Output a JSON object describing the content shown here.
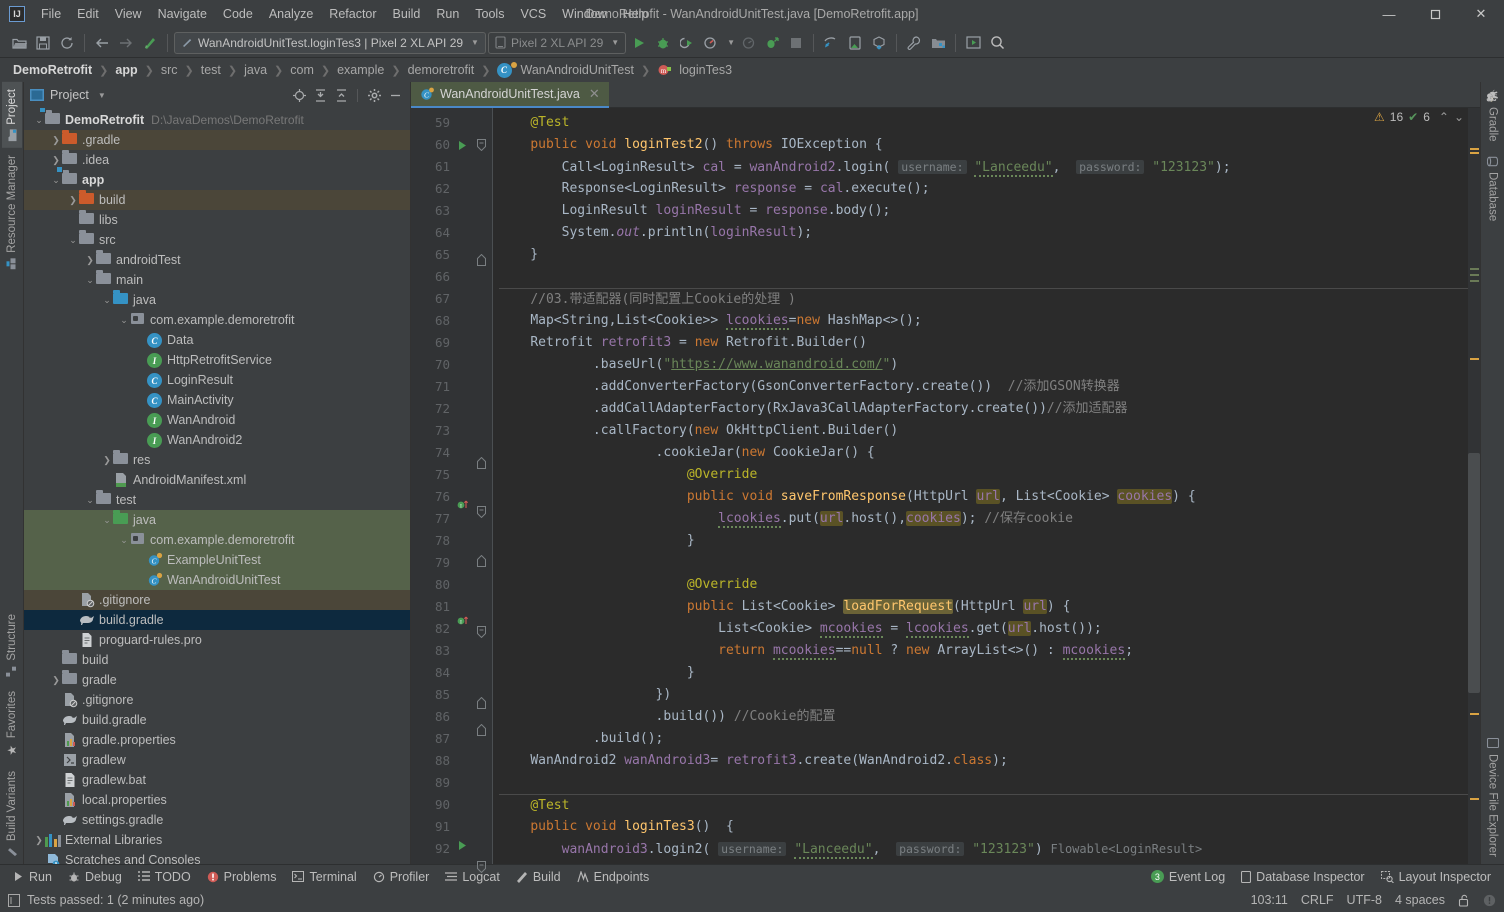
{
  "window": {
    "title": "DemoRetrofit - WanAndroidUnitTest.java [DemoRetrofit.app]",
    "logo": "IJ",
    "minimize": "—",
    "maximize": "☐",
    "close": "✕"
  },
  "menu": [
    "File",
    "Edit",
    "View",
    "Navigate",
    "Code",
    "Analyze",
    "Refactor",
    "Build",
    "Run",
    "Tools",
    "VCS",
    "Window",
    "Help"
  ],
  "toolbar": {
    "icons_left": [
      "open-icon",
      "save-icon",
      "sync-icon"
    ],
    "nav_icons": [
      "back-icon",
      "forward-icon",
      "update-project-icon"
    ],
    "run_config": "WanAndroidUnitTest.loginTes3 | Pixel 2 XL API 29",
    "device": "Pixel 2 XL API 29",
    "icons_right": [
      "run-icon",
      "debug-icon",
      "run-coverage-icon",
      "profile-icon",
      "attach-debugger-icon",
      "apply-changes-icon",
      "stop-icon",
      "sync-gradle-icon",
      "avd-manager-icon",
      "sdk-manager-icon",
      "wrench-icon",
      "project-structure-icon",
      "layout-editor-icon",
      "search-everywhere-icon"
    ]
  },
  "breadcrumb": [
    {
      "label": "DemoRetrofit",
      "bold": true,
      "icon": ""
    },
    {
      "label": "app",
      "bold": true,
      "icon": ""
    },
    {
      "label": "src",
      "bold": false,
      "icon": ""
    },
    {
      "label": "test",
      "bold": false,
      "icon": ""
    },
    {
      "label": "java",
      "bold": false,
      "icon": ""
    },
    {
      "label": "com",
      "bold": false,
      "icon": ""
    },
    {
      "label": "example",
      "bold": false,
      "icon": ""
    },
    {
      "label": "demoretrofit",
      "bold": false,
      "icon": ""
    },
    {
      "label": "WanAndroidUnitTest",
      "bold": false,
      "icon": "class-icon"
    },
    {
      "label": "loginTes3",
      "bold": false,
      "icon": "method-icon"
    }
  ],
  "left_strip": {
    "top": [
      {
        "label": "Project",
        "icon": "project-icon",
        "active": true
      },
      {
        "label": "Resource Manager",
        "icon": "resource-icon",
        "active": false
      }
    ],
    "bottom": [
      {
        "label": "Structure",
        "icon": "structure-icon"
      },
      {
        "label": "Favorites",
        "icon": "star-icon"
      },
      {
        "label": "Build Variants",
        "icon": "build-variants-icon"
      }
    ]
  },
  "right_strip": {
    "top": [
      {
        "label": "Gradle",
        "icon": "gradle-icon"
      },
      {
        "label": "Database",
        "icon": "database-icon"
      }
    ],
    "bottom": [
      {
        "label": "Device File Explorer",
        "icon": "device-file-explorer-icon"
      }
    ]
  },
  "project_panel": {
    "title": "Project",
    "tools": [
      "locate-icon",
      "expand-all-icon",
      "collapse-all-icon",
      "settings-icon",
      "hide-icon"
    ],
    "tree": [
      {
        "depth": 0,
        "arrow": "v",
        "icon": "module-folder",
        "label": "DemoRetrofit",
        "bold": true,
        "path": "D:\\JavaDemos\\DemoRetrofit",
        "state": "none"
      },
      {
        "depth": 1,
        "arrow": ">",
        "icon": "folder-orange",
        "label": ".gradle",
        "bold": false,
        "path": "",
        "state": "tan"
      },
      {
        "depth": 1,
        "arrow": ">",
        "icon": "folder-gray",
        "label": ".idea",
        "bold": false,
        "path": "",
        "state": "none"
      },
      {
        "depth": 1,
        "arrow": "v",
        "icon": "module-folder",
        "label": "app",
        "bold": true,
        "path": "",
        "state": "none"
      },
      {
        "depth": 2,
        "arrow": ">",
        "icon": "folder-orange",
        "label": "build",
        "bold": false,
        "path": "",
        "state": "tan"
      },
      {
        "depth": 2,
        "arrow": "",
        "icon": "folder-gray",
        "label": "libs",
        "bold": false,
        "path": "",
        "state": "none"
      },
      {
        "depth": 2,
        "arrow": "v",
        "icon": "folder-gray",
        "label": "src",
        "bold": false,
        "path": "",
        "state": "none"
      },
      {
        "depth": 3,
        "arrow": ">",
        "icon": "folder-gray",
        "label": "androidTest",
        "bold": false,
        "path": "",
        "state": "none"
      },
      {
        "depth": 3,
        "arrow": "v",
        "icon": "folder-gray",
        "label": "main",
        "bold": false,
        "path": "",
        "state": "none"
      },
      {
        "depth": 4,
        "arrow": "v",
        "icon": "folder-blue",
        "label": "java",
        "bold": false,
        "path": "",
        "state": "none"
      },
      {
        "depth": 5,
        "arrow": "v",
        "icon": "package",
        "label": "com.example.demoretrofit",
        "bold": false,
        "path": "",
        "state": "none"
      },
      {
        "depth": 6,
        "arrow": "",
        "icon": "class-c",
        "label": "Data",
        "bold": false,
        "path": "",
        "state": "none"
      },
      {
        "depth": 6,
        "arrow": "",
        "icon": "iface-i",
        "label": "HttpRetrofitService",
        "bold": false,
        "path": "",
        "state": "none"
      },
      {
        "depth": 6,
        "arrow": "",
        "icon": "class-c",
        "label": "LoginResult",
        "bold": false,
        "path": "",
        "state": "none"
      },
      {
        "depth": 6,
        "arrow": "",
        "icon": "class-c",
        "label": "MainActivity",
        "bold": false,
        "path": "",
        "state": "none"
      },
      {
        "depth": 6,
        "arrow": "",
        "icon": "iface-i",
        "label": "WanAndroid",
        "bold": false,
        "path": "",
        "state": "none"
      },
      {
        "depth": 6,
        "arrow": "",
        "icon": "iface-i",
        "label": "WanAndroid2",
        "bold": false,
        "path": "",
        "state": "none"
      },
      {
        "depth": 4,
        "arrow": ">",
        "icon": "folder-res",
        "label": "res",
        "bold": false,
        "path": "",
        "state": "none"
      },
      {
        "depth": 4,
        "arrow": "",
        "icon": "manifest",
        "label": "AndroidManifest.xml",
        "bold": false,
        "path": "",
        "state": "none"
      },
      {
        "depth": 3,
        "arrow": "v",
        "icon": "folder-gray",
        "label": "test",
        "bold": false,
        "path": "",
        "state": "none"
      },
      {
        "depth": 4,
        "arrow": "v",
        "icon": "folder-green",
        "label": "java",
        "bold": false,
        "path": "",
        "state": "green"
      },
      {
        "depth": 5,
        "arrow": "v",
        "icon": "package",
        "label": "com.example.demoretrofit",
        "bold": false,
        "path": "",
        "state": "green"
      },
      {
        "depth": 6,
        "arrow": "",
        "icon": "class-test",
        "label": "ExampleUnitTest",
        "bold": false,
        "path": "",
        "state": "green"
      },
      {
        "depth": 6,
        "arrow": "",
        "icon": "class-test",
        "label": "WanAndroidUnitTest",
        "bold": false,
        "path": "",
        "state": "green"
      },
      {
        "depth": 2,
        "arrow": "",
        "icon": "gitignore",
        "label": ".gitignore",
        "bold": false,
        "path": "",
        "state": "tan"
      },
      {
        "depth": 2,
        "arrow": "",
        "icon": "gradle-file",
        "label": "build.gradle",
        "bold": false,
        "path": "",
        "state": "blue"
      },
      {
        "depth": 2,
        "arrow": "",
        "icon": "text-file",
        "label": "proguard-rules.pro",
        "bold": false,
        "path": "",
        "state": "none"
      },
      {
        "depth": 1,
        "arrow": "",
        "icon": "folder-gray",
        "label": "build",
        "bold": false,
        "path": "",
        "state": "none"
      },
      {
        "depth": 1,
        "arrow": ">",
        "icon": "folder-gray",
        "label": "gradle",
        "bold": false,
        "path": "",
        "state": "none"
      },
      {
        "depth": 1,
        "arrow": "",
        "icon": "gitignore",
        "label": ".gitignore",
        "bold": false,
        "path": "",
        "state": "none"
      },
      {
        "depth": 1,
        "arrow": "",
        "icon": "gradle-file",
        "label": "build.gradle",
        "bold": false,
        "path": "",
        "state": "none"
      },
      {
        "depth": 1,
        "arrow": "",
        "icon": "properties",
        "label": "gradle.properties",
        "bold": false,
        "path": "",
        "state": "none"
      },
      {
        "depth": 1,
        "arrow": "",
        "icon": "script",
        "label": "gradlew",
        "bold": false,
        "path": "",
        "state": "none"
      },
      {
        "depth": 1,
        "arrow": "",
        "icon": "text-file",
        "label": "gradlew.bat",
        "bold": false,
        "path": "",
        "state": "none"
      },
      {
        "depth": 1,
        "arrow": "",
        "icon": "properties",
        "label": "local.properties",
        "bold": false,
        "path": "",
        "state": "none"
      },
      {
        "depth": 1,
        "arrow": "",
        "icon": "gradle-file",
        "label": "settings.gradle",
        "bold": false,
        "path": "",
        "state": "none"
      },
      {
        "depth": 0,
        "arrow": ">",
        "icon": "libraries",
        "label": "External Libraries",
        "bold": false,
        "path": "",
        "state": "none"
      },
      {
        "depth": 0,
        "arrow": "",
        "icon": "scratches",
        "label": "Scratches and Consoles",
        "bold": false,
        "path": "",
        "state": "none"
      }
    ]
  },
  "editor": {
    "tab": {
      "label": "WanAndroidUnitTest.java",
      "icon": "java-test-class-icon",
      "close": "✕"
    },
    "inspection": {
      "warnings": "16",
      "warn_icon": "warning-triangle-icon",
      "passed": "6",
      "ok_icon": "inspection-ok-icon",
      "up": "⌃",
      "down": "⌄"
    },
    "first_line": 59,
    "lines": [
      {
        "n": 59,
        "run": false,
        "fold": "",
        "sep": false
      },
      {
        "n": 60,
        "run": true,
        "fold": "minus",
        "sep": false
      },
      {
        "n": 61,
        "run": false,
        "fold": "",
        "sep": false
      },
      {
        "n": 62,
        "run": false,
        "fold": "",
        "sep": false
      },
      {
        "n": 63,
        "run": false,
        "fold": "",
        "sep": false
      },
      {
        "n": 64,
        "run": false,
        "fold": "",
        "sep": false
      },
      {
        "n": 65,
        "run": false,
        "fold": "end",
        "sep": false
      },
      {
        "n": 66,
        "run": false,
        "fold": "",
        "sep": false
      },
      {
        "n": 67,
        "run": false,
        "fold": "",
        "sep": true
      },
      {
        "n": 68,
        "run": false,
        "fold": "",
        "sep": false
      },
      {
        "n": 69,
        "run": false,
        "fold": "",
        "sep": false
      },
      {
        "n": 70,
        "run": false,
        "fold": "",
        "sep": false
      },
      {
        "n": 71,
        "run": false,
        "fold": "",
        "sep": false
      },
      {
        "n": 72,
        "run": false,
        "fold": "",
        "sep": false
      },
      {
        "n": 73,
        "run": false,
        "fold": "",
        "sep": false
      },
      {
        "n": 74,
        "run": false,
        "fold": "end",
        "sep": false
      },
      {
        "n": 75,
        "run": false,
        "fold": "",
        "sep": false
      },
      {
        "n": 76,
        "run": "gutter-impl",
        "fold": "minus",
        "sep": false
      },
      {
        "n": 77,
        "run": false,
        "fold": "",
        "sep": false
      },
      {
        "n": 78,
        "run": false,
        "fold": "end",
        "sep": false
      },
      {
        "n": 79,
        "run": false,
        "fold": "",
        "sep": false
      },
      {
        "n": 80,
        "run": false,
        "fold": "",
        "sep": false
      },
      {
        "n": 81,
        "run": "gutter-impl",
        "fold": "minus",
        "sep": false
      },
      {
        "n": 82,
        "run": false,
        "fold": "",
        "sep": false
      },
      {
        "n": 83,
        "run": false,
        "fold": "",
        "sep": false
      },
      {
        "n": 84,
        "run": false,
        "fold": "end",
        "sep": false
      },
      {
        "n": 85,
        "run": false,
        "fold": "end",
        "sep": false
      },
      {
        "n": 86,
        "run": false,
        "fold": "",
        "sep": false
      },
      {
        "n": 87,
        "run": false,
        "fold": "",
        "sep": false
      },
      {
        "n": 88,
        "run": false,
        "fold": "",
        "sep": false
      },
      {
        "n": 89,
        "run": false,
        "fold": "",
        "sep": false
      },
      {
        "n": 90,
        "run": false,
        "fold": "",
        "sep": true
      },
      {
        "n": 91,
        "run": true,
        "fold": "minus",
        "sep": false
      },
      {
        "n": 92,
        "run": false,
        "fold": "",
        "sep": false
      }
    ],
    "source_text": [
      "    @Test",
      "    public void loginTest2() throws IOException {",
      "        Call<LoginResult> cal = wanAndroid2.login( username: \"Lanceedu\",  password: \"123123\");",
      "        Response<LoginResult> response = cal.execute();",
      "        LoginResult loginResult = response.body();",
      "        System.out.println(loginResult);",
      "    }",
      "",
      "    //03.带适配器(同时配置上Cookie的处理 )",
      "    Map<String,List<Cookie>> lcookies=new HashMap<>();",
      "    Retrofit retrofit3 = new Retrofit.Builder()",
      "            .baseUrl(\"https://www.wanandroid.com/\")",
      "            .addConverterFactory(GsonConverterFactory.create())  //添加GSON转换器",
      "            .addCallAdapterFactory(RxJava3CallAdapterFactory.create())//添加适配器",
      "            .callFactory(new OkHttpClient.Builder()",
      "                    .cookieJar(new CookieJar() {",
      "                        @Override",
      "                        public void saveFromResponse(HttpUrl url, List<Cookie> cookies) {",
      "                            lcookies.put(url.host(),cookies); //保存cookie",
      "                        }",
      "",
      "                        @Override",
      "                        public List<Cookie> loadForRequest(HttpUrl url) {",
      "                            List<Cookie> mcookies = lcookies.get(url.host());",
      "                            return mcookies==null ? new ArrayList<>() : mcookies;",
      "                        }",
      "                    })",
      "                    .build()) //Cookie的配置",
      "            .build();",
      "    WanAndroid2 wanAndroid3= retrofit3.create(WanAndroid2.class);",
      "",
      "    @Test",
      "    public void loginTes3()  {",
      "        wanAndroid3.login2( username: \"Lanceedu\",  password: \"123123\") Flowable<LoginResult>"
    ]
  },
  "bottom_tabs": [
    {
      "label": "Run",
      "icon": "run-icon"
    },
    {
      "label": "Debug",
      "icon": "debug-icon"
    },
    {
      "label": "TODO",
      "icon": "todo-icon"
    },
    {
      "label": "Problems",
      "icon": "problems-icon"
    },
    {
      "label": "Terminal",
      "icon": "terminal-icon"
    },
    {
      "label": "Profiler",
      "icon": "profiler-icon"
    },
    {
      "label": "Logcat",
      "icon": "logcat-icon"
    },
    {
      "label": "Build",
      "icon": "build-icon"
    },
    {
      "label": "Endpoints",
      "icon": "endpoints-icon"
    }
  ],
  "bottom_tabs_right": [
    {
      "label": "Event Log",
      "icon": "event-log-icon",
      "count": "3"
    },
    {
      "label": "Database Inspector",
      "icon": "database-inspector-icon",
      "count": ""
    },
    {
      "label": "Layout Inspector",
      "icon": "layout-inspector-icon",
      "count": ""
    }
  ],
  "statusbar": {
    "icon": "test-status-icon",
    "message": "Tests passed: 1 (2 minutes ago)",
    "caret": "103:11",
    "line_sep": "CRLF",
    "encoding": "UTF-8",
    "indent": "4 spaces",
    "lock_icon": "unlock-icon",
    "notify_icon": "notification-icon"
  },
  "colors": {
    "bg_chrome": "#3c3f41",
    "bg_editor": "#2b2b2b",
    "bg_gutter": "#313335",
    "accent_blue": "#4a88c7",
    "select_blue": "#0d293e",
    "select_green": "#55624a",
    "tan_row": "#4b4639",
    "keyword": "#cc7832",
    "string": "#6a8759",
    "number": "#6897bb",
    "comment": "#808080",
    "field": "#9876aa",
    "method": "#ffc66d",
    "annotation": "#bbb529",
    "text": "#a9b7c6",
    "warn": "#d9a343",
    "green": "#499c54",
    "red": "#cf5b56"
  }
}
